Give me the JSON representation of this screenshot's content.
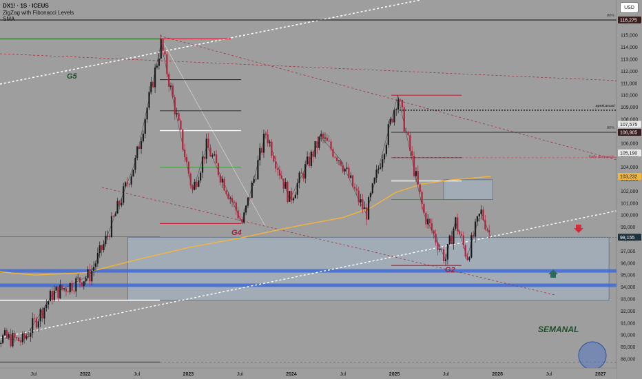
{
  "header": {
    "symbol": "DX1! · 1S · ICEUS",
    "indicator_zigzag": "ZigZag with Fibonacci Levels",
    "indicator_sma": "SMA"
  },
  "toolbar": {
    "currency_label": "USD"
  },
  "colors": {
    "background": "#9e9e9e",
    "up_candle": "#1b1b1b",
    "down_candle": "#b2223c",
    "sma": "#f4b63a",
    "zone_fill": "#a6b8cc",
    "zone_blue_line": "#3f6ad8",
    "fib_red": "#c7243a",
    "fib_green": "#3d9a3d",
    "label_dark_green": "#1f4f2c",
    "label_red": "#a0203a",
    "arrow_down": "#d42c3c",
    "arrow_up": "#2b6a5a",
    "price_tag_current": "#1e3340",
    "price_tag_dark": "#3a1d1d",
    "price_tag_sma": "#f4b63a",
    "circle_fill": "#5878c0"
  },
  "chart_data": {
    "type": "candlestick",
    "title": "DX1! · 1S · ICEUS",
    "x_tick_labels": [
      "Jul",
      "2022",
      "Jul",
      "2023",
      "Jul",
      "2024",
      "Jul",
      "2025",
      "Jul",
      "2026",
      "Jul",
      "2027"
    ],
    "x_tick_dates": [
      "2021-07",
      "2022-01",
      "2022-07",
      "2023-01",
      "2023-07",
      "2024-01",
      "2024-07",
      "2025-01",
      "2025-07",
      "2026-01",
      "2026-07",
      "2027-01"
    ],
    "y_ticks": [
      88000,
      89000,
      90000,
      91000,
      92000,
      93000,
      94000,
      95000,
      96000,
      97000,
      98000,
      99000,
      100000,
      101000,
      102000,
      103000,
      104000,
      105000,
      106000,
      107000,
      108000,
      109000,
      110000,
      111000,
      112000,
      113000,
      114000,
      115000
    ],
    "y_range": [
      87200,
      117500
    ],
    "y_scale": "linear",
    "grid": false,
    "price_swings": {
      "dates": [
        "2021-01-04",
        "2021-05-24",
        "2021-09-06",
        "2022-01-17",
        "2022-03-07",
        "2022-06-27",
        "2022-09-26",
        "2023-01-16",
        "2023-03-06",
        "2023-07-10",
        "2023-10-02",
        "2023-12-25",
        "2024-04-15",
        "2024-06-24",
        "2024-08-26",
        "2024-09-23",
        "2025-01-13",
        "2025-04-14",
        "2025-06-30",
        "2025-08-04",
        "2025-09-15",
        "2025-11-03",
        "2025-12-08"
      ],
      "close": [
        90000,
        89500,
        93400,
        95000,
        97600,
        104500,
        114300,
        102000,
        105800,
        99300,
        106900,
        101300,
        106500,
        104600,
        101300,
        100100,
        110000,
        100100,
        96300,
        99500,
        96500,
        100300,
        98155
      ]
    },
    "last_price": 98155,
    "price_tags": [
      116275,
      107575,
      106905,
      105190,
      103232,
      98155
    ],
    "moving_average": {
      "name": "SMA",
      "dates": [
        "2021-01-04",
        "2021-07-05",
        "2022-01-03",
        "2022-07-04",
        "2023-01-02",
        "2023-07-03",
        "2024-01-01",
        "2024-07-01",
        "2024-10-07",
        "2025-01-06",
        "2025-04-07",
        "2025-07-07",
        "2025-10-06",
        "2025-12-08"
      ],
      "values": [
        95400,
        95000,
        95200,
        96300,
        97300,
        98100,
        99000,
        99800,
        100600,
        101900,
        102600,
        102900,
        103100,
        103232
      ]
    },
    "horizontal_levels": [
      {
        "value": 116275,
        "note": "80%"
      },
      {
        "value": 108750,
        "note": "apert.anual"
      },
      {
        "value": 106905,
        "note": "80%"
      },
      {
        "value": 104790,
        "note": "Fallo del precio"
      }
    ],
    "zones": [
      {
        "from": "2022-05-30",
        "to": "2027-01-31",
        "low": 92900,
        "high": 98155
      },
      {
        "from": "2025-06-23",
        "to": "2025-12-15",
        "low": 101300,
        "high": 102950
      }
    ],
    "annotations": [
      "G5",
      "G4",
      "G2",
      "SEMANAL",
      "apert.anual",
      "Fallo del precio",
      "80%",
      "80%"
    ]
  }
}
